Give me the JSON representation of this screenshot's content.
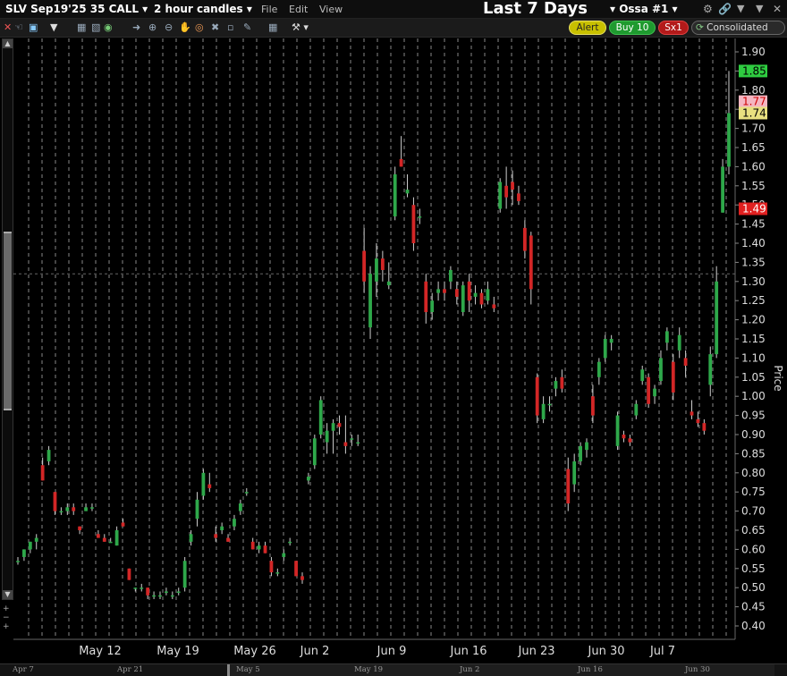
{
  "titlebar": {
    "contract": "SLV Sep19'25 35 CALL",
    "period": "2 hour candles",
    "menu": [
      "File",
      "Edit",
      "View"
    ],
    "range_title": "Last 7 Days",
    "group": "Ossa #1",
    "icons": [
      "gear-icon",
      "link-icon",
      "collapse-icon",
      "close-icon"
    ]
  },
  "toolbar": {
    "tools": [
      "close-icon",
      "crosshair-icon",
      "magnifier-icon",
      "dropdown-icon",
      "bars-icon",
      "candles-icon",
      "line-icon",
      "area-icon",
      "globe-icon",
      "pointer-icon",
      "zoom-in-icon",
      "zoom-out-icon",
      "hand-icon",
      "target-icon",
      "delete-icon",
      "eraser-icon",
      "pencil-icon",
      "grid-icon",
      "layout-icon",
      "wrench-icon"
    ],
    "alert_label": "Alert",
    "buy_label": "Buy 10",
    "sell_label": "Sx1",
    "consolidated_label": "Consolidated"
  },
  "colors": {
    "up": "#2ea84a",
    "down": "#d32626",
    "grid": "#c8c8c8",
    "last_price": "#2ecc40",
    "ask": "#f4b6c2",
    "bid": "#e8e080",
    "low": "#e02020"
  },
  "axis": {
    "label": "Price",
    "ticks": [
      "1.90",
      "1.85",
      "1.80",
      "1.75",
      "1.70",
      "1.65",
      "1.60",
      "1.55",
      "1.50",
      "1.45",
      "1.40",
      "1.35",
      "1.30",
      "1.25",
      "1.20",
      "1.15",
      "1.10",
      "1.05",
      "1.00",
      "0.95",
      "0.90",
      "0.85",
      "0.80",
      "0.75",
      "0.70",
      "0.65",
      "0.60",
      "0.55",
      "0.50",
      "0.45",
      "0.40"
    ],
    "price_tags": [
      {
        "text": "1.85",
        "value": 1.85,
        "color": "#2ecc40",
        "fg": "#000"
      },
      {
        "text": "1.77",
        "value": 1.77,
        "color": "#f4b6c2",
        "fg": "#c00"
      },
      {
        "text": "1.74",
        "value": 1.74,
        "color": "#e8e080",
        "fg": "#000"
      },
      {
        "text": "1.49",
        "value": 1.49,
        "color": "#e02020",
        "fg": "#fff"
      }
    ]
  },
  "x_axis": {
    "labels": [
      "May 12",
      "May 19",
      "May 26",
      "Jun 2",
      "Jun 9",
      "Jun 16",
      "Jun 23",
      "Jun 30",
      "Jul 7"
    ]
  },
  "overview": {
    "labels": [
      "Apr 7",
      "Apr 21",
      "May 5",
      "May 19",
      "Jun 2",
      "Jun 16",
      "Jun 30"
    ]
  },
  "chart_data": {
    "type": "candlestick",
    "ylim": [
      0.38,
      1.92
    ],
    "ylabel": "Price",
    "crosshair_price": 1.32,
    "candles": [
      [
        0.57,
        0.58,
        0.56,
        0.57
      ],
      [
        0.58,
        0.6,
        0.57,
        0.6
      ],
      [
        0.6,
        0.62,
        0.59,
        0.62
      ],
      [
        0.62,
        0.64,
        0.6,
        0.63
      ],
      [
        0.82,
        0.84,
        0.78,
        0.78
      ],
      [
        0.83,
        0.87,
        0.82,
        0.86
      ],
      [
        0.75,
        0.75,
        0.69,
        0.7
      ],
      [
        0.7,
        0.71,
        0.69,
        0.7
      ],
      [
        0.7,
        0.72,
        0.69,
        0.71
      ],
      [
        0.71,
        0.72,
        0.69,
        0.7
      ],
      [
        0.66,
        0.66,
        0.64,
        0.65
      ],
      [
        0.7,
        0.72,
        0.7,
        0.71
      ],
      [
        0.71,
        0.72,
        0.7,
        0.71
      ],
      [
        0.64,
        0.65,
        0.63,
        0.63
      ],
      [
        0.63,
        0.64,
        0.62,
        0.62
      ],
      [
        0.62,
        0.63,
        0.62,
        0.62
      ],
      [
        0.61,
        0.66,
        0.61,
        0.65
      ],
      [
        0.67,
        0.68,
        0.66,
        0.66
      ],
      [
        0.55,
        0.55,
        0.52,
        0.52
      ],
      [
        0.5,
        0.5,
        0.49,
        0.5
      ],
      [
        0.5,
        0.51,
        0.49,
        0.5
      ],
      [
        0.5,
        0.5,
        0.47,
        0.48
      ],
      [
        0.48,
        0.49,
        0.47,
        0.48
      ],
      [
        0.48,
        0.49,
        0.47,
        0.48
      ],
      [
        0.49,
        0.5,
        0.48,
        0.49
      ],
      [
        0.48,
        0.49,
        0.47,
        0.48
      ],
      [
        0.49,
        0.5,
        0.48,
        0.49
      ],
      [
        0.5,
        0.58,
        0.49,
        0.57
      ],
      [
        0.62,
        0.65,
        0.61,
        0.64
      ],
      [
        0.68,
        0.75,
        0.66,
        0.73
      ],
      [
        0.74,
        0.81,
        0.73,
        0.8
      ],
      [
        0.77,
        0.8,
        0.75,
        0.76
      ],
      [
        0.64,
        0.66,
        0.62,
        0.63
      ],
      [
        0.65,
        0.67,
        0.64,
        0.66
      ],
      [
        0.63,
        0.64,
        0.62,
        0.62
      ],
      [
        0.66,
        0.69,
        0.65,
        0.68
      ],
      [
        0.7,
        0.73,
        0.69,
        0.72
      ],
      [
        0.75,
        0.76,
        0.74,
        0.75
      ],
      [
        0.62,
        0.63,
        0.6,
        0.6
      ],
      [
        0.6,
        0.62,
        0.59,
        0.61
      ],
      [
        0.61,
        0.62,
        0.59,
        0.59
      ],
      [
        0.57,
        0.58,
        0.53,
        0.54
      ],
      [
        0.54,
        0.55,
        0.53,
        0.54
      ],
      [
        0.58,
        0.6,
        0.57,
        0.59
      ],
      [
        0.62,
        0.63,
        0.61,
        0.62
      ],
      [
        0.57,
        0.57,
        0.53,
        0.53
      ],
      [
        0.53,
        0.54,
        0.51,
        0.52
      ],
      [
        0.78,
        0.8,
        0.77,
        0.79
      ],
      [
        0.82,
        0.9,
        0.81,
        0.89
      ],
      [
        0.9,
        1.0,
        0.89,
        0.99
      ],
      [
        0.88,
        0.93,
        0.85,
        0.91
      ],
      [
        0.91,
        0.94,
        0.85,
        0.93
      ],
      [
        0.93,
        0.95,
        0.9,
        0.92
      ],
      [
        0.88,
        0.95,
        0.85,
        0.87
      ],
      [
        0.89,
        0.9,
        0.87,
        0.89
      ],
      [
        0.88,
        0.9,
        0.87,
        0.88
      ],
      [
        1.38,
        1.44,
        1.27,
        1.3
      ],
      [
        1.18,
        1.34,
        1.15,
        1.32
      ],
      [
        1.3,
        1.4,
        1.26,
        1.36
      ],
      [
        1.36,
        1.38,
        1.3,
        1.33
      ],
      [
        1.29,
        1.35,
        1.28,
        1.3
      ],
      [
        1.47,
        1.6,
        1.46,
        1.58
      ],
      [
        1.62,
        1.68,
        1.6,
        1.6
      ],
      [
        1.53,
        1.58,
        1.52,
        1.54
      ],
      [
        1.5,
        1.52,
        1.38,
        1.4
      ],
      [
        1.47,
        1.49,
        1.45,
        1.47
      ],
      [
        1.3,
        1.32,
        1.19,
        1.22
      ],
      [
        1.22,
        1.27,
        1.2,
        1.25
      ],
      [
        1.27,
        1.3,
        1.25,
        1.28
      ],
      [
        1.28,
        1.3,
        1.25,
        1.27
      ],
      [
        1.3,
        1.34,
        1.28,
        1.33
      ],
      [
        1.28,
        1.3,
        1.24,
        1.26
      ],
      [
        1.22,
        1.3,
        1.21,
        1.29
      ],
      [
        1.3,
        1.32,
        1.22,
        1.25
      ],
      [
        1.26,
        1.29,
        1.24,
        1.27
      ],
      [
        1.27,
        1.28,
        1.23,
        1.24
      ],
      [
        1.25,
        1.3,
        1.24,
        1.28
      ],
      [
        1.24,
        1.26,
        1.22,
        1.23
      ],
      [
        1.49,
        1.57,
        1.48,
        1.56
      ],
      [
        1.55,
        1.6,
        1.49,
        1.52
      ],
      [
        1.56,
        1.59,
        1.5,
        1.54
      ],
      [
        1.53,
        1.55,
        1.5,
        1.51
      ],
      [
        1.44,
        1.46,
        1.36,
        1.38
      ],
      [
        1.42,
        1.43,
        1.24,
        1.28
      ],
      [
        1.05,
        1.06,
        0.93,
        0.95
      ],
      [
        0.94,
        1.0,
        0.93,
        0.98
      ],
      [
        0.98,
        1.0,
        0.96,
        0.98
      ],
      [
        1.02,
        1.05,
        1.0,
        1.04
      ],
      [
        1.05,
        1.07,
        1.01,
        1.02
      ],
      [
        0.81,
        0.84,
        0.7,
        0.72
      ],
      [
        0.77,
        0.85,
        0.75,
        0.83
      ],
      [
        0.83,
        0.88,
        0.82,
        0.87
      ],
      [
        0.86,
        0.89,
        0.84,
        0.88
      ],
      [
        1.0,
        1.03,
        0.93,
        0.95
      ],
      [
        1.05,
        1.1,
        1.03,
        1.09
      ],
      [
        1.1,
        1.16,
        1.09,
        1.15
      ],
      [
        1.14,
        1.16,
        1.12,
        1.15
      ],
      [
        0.87,
        0.96,
        0.86,
        0.95
      ],
      [
        0.9,
        0.91,
        0.88,
        0.89
      ],
      [
        0.89,
        0.9,
        0.87,
        0.88
      ],
      [
        0.95,
        0.99,
        0.94,
        0.98
      ],
      [
        1.04,
        1.08,
        1.03,
        1.07
      ],
      [
        1.05,
        1.06,
        0.97,
        0.98
      ],
      [
        1.0,
        1.03,
        0.98,
        1.02
      ],
      [
        1.04,
        1.12,
        1.03,
        1.1
      ],
      [
        1.14,
        1.18,
        1.12,
        1.17
      ],
      [
        1.09,
        1.11,
        0.99,
        1.01
      ],
      [
        1.12,
        1.18,
        1.1,
        1.16
      ],
      [
        1.1,
        1.12,
        1.05,
        1.08
      ],
      [
        0.96,
        0.99,
        0.94,
        0.95
      ],
      [
        0.94,
        0.96,
        0.92,
        0.93
      ],
      [
        0.93,
        0.94,
        0.9,
        0.91
      ],
      [
        1.03,
        1.13,
        1.0,
        1.11
      ],
      [
        1.11,
        1.34,
        1.1,
        1.3
      ],
      [
        1.48,
        1.62,
        1.48,
        1.6
      ],
      [
        1.6,
        1.85,
        1.58,
        1.74
      ]
    ]
  }
}
